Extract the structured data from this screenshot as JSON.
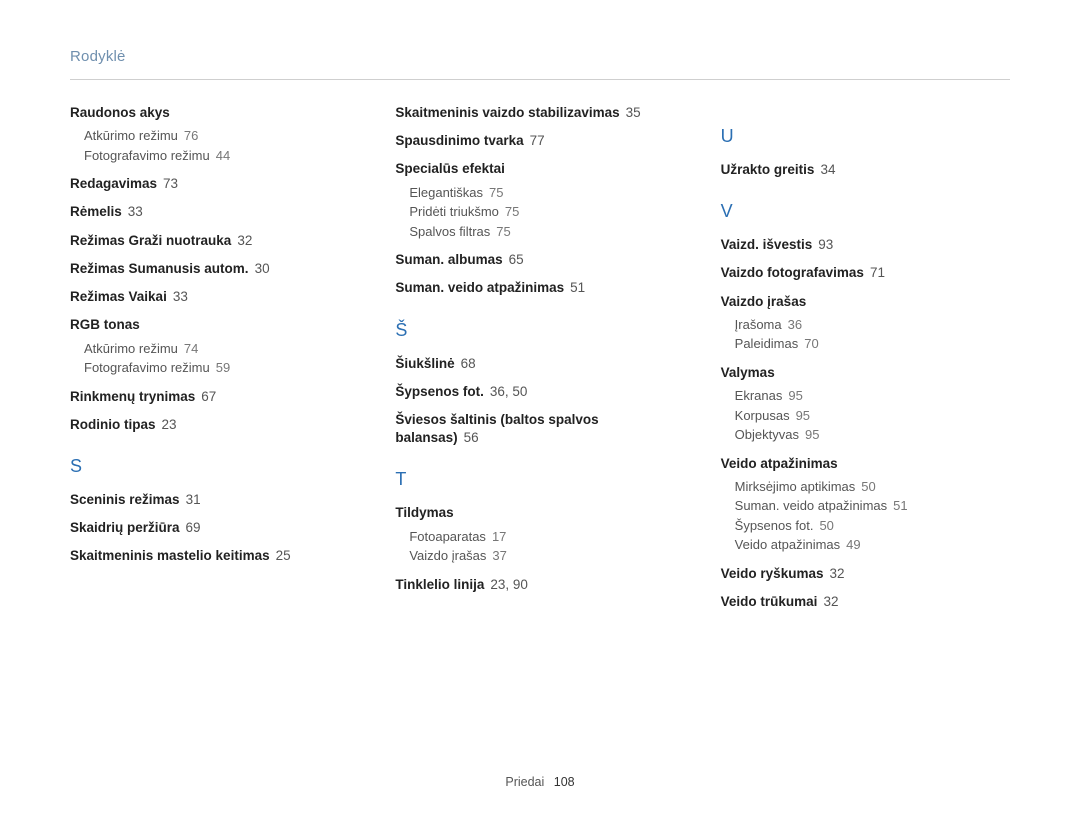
{
  "header": {
    "title": "Rodyklė"
  },
  "footer": {
    "label": "Priedai",
    "page": "108"
  },
  "columns": [
    {
      "blocks": [
        {
          "type": "entries",
          "items": [
            {
              "label": "Raudonos akys",
              "pages": "",
              "sub": [
                {
                  "label": "Atkūrimo režimu",
                  "pages": "76"
                },
                {
                  "label": "Fotografavimo režimu",
                  "pages": "44"
                }
              ]
            },
            {
              "label": "Redagavimas",
              "pages": "73"
            },
            {
              "label": "Rėmelis",
              "pages": "33"
            },
            {
              "label": "Režimas Graži nuotrauka",
              "pages": "32"
            },
            {
              "label": "Režimas Sumanusis autom.",
              "pages": "30"
            },
            {
              "label": "Režimas Vaikai",
              "pages": "33"
            },
            {
              "label": "RGB tonas",
              "pages": "",
              "sub": [
                {
                  "label": "Atkūrimo režimu",
                  "pages": "74"
                },
                {
                  "label": "Fotografavimo režimu",
                  "pages": "59"
                }
              ]
            },
            {
              "label": "Rinkmenų trynimas",
              "pages": "67"
            },
            {
              "label": "Rodinio tipas",
              "pages": "23"
            }
          ]
        },
        {
          "type": "letter",
          "value": "S"
        },
        {
          "type": "entries",
          "items": [
            {
              "label": "Sceninis režimas",
              "pages": "31"
            },
            {
              "label": "Skaidrių peržiūra",
              "pages": "69"
            },
            {
              "label": "Skaitmeninis mastelio keitimas",
              "pages": "25"
            }
          ]
        }
      ]
    },
    {
      "blocks": [
        {
          "type": "entries",
          "items": [
            {
              "label": "Skaitmeninis vaizdo stabilizavimas",
              "pages": "35"
            },
            {
              "label": "Spausdinimo tvarka",
              "pages": "77"
            },
            {
              "label": "Specialūs efektai",
              "pages": "",
              "sub": [
                {
                  "label": "Elegantiškas",
                  "pages": "75"
                },
                {
                  "label": "Pridėti triukšmo",
                  "pages": "75"
                },
                {
                  "label": "Spalvos filtras",
                  "pages": "75"
                }
              ]
            },
            {
              "label": "Suman. albumas",
              "pages": "65"
            },
            {
              "label": "Suman. veido atpažinimas",
              "pages": "51"
            }
          ]
        },
        {
          "type": "letter",
          "value": "Š"
        },
        {
          "type": "entries",
          "items": [
            {
              "label": "Šiukšlinė",
              "pages": "68"
            },
            {
              "label": "Šypsenos fot.",
              "pages": "36, 50"
            },
            {
              "label": "Šviesos šaltinis (baltos spalvos balansas)",
              "pages": "56"
            }
          ]
        },
        {
          "type": "letter",
          "value": "T"
        },
        {
          "type": "entries",
          "items": [
            {
              "label": "Tildymas",
              "pages": "",
              "sub": [
                {
                  "label": "Fotoaparatas",
                  "pages": "17"
                },
                {
                  "label": "Vaizdo įrašas",
                  "pages": "37"
                }
              ]
            },
            {
              "label": "Tinklelio linija",
              "pages": "23, 90"
            }
          ]
        }
      ]
    },
    {
      "blocks": [
        {
          "type": "letter",
          "value": "U"
        },
        {
          "type": "entries",
          "items": [
            {
              "label": "Užrakto greitis",
              "pages": "34"
            }
          ]
        },
        {
          "type": "letter",
          "value": "V"
        },
        {
          "type": "entries",
          "items": [
            {
              "label": "Vaizd. išvestis",
              "pages": "93"
            },
            {
              "label": "Vaizdo fotografavimas",
              "pages": "71"
            },
            {
              "label": "Vaizdo įrašas",
              "pages": "",
              "sub": [
                {
                  "label": "Įrašoma",
                  "pages": "36"
                },
                {
                  "label": "Paleidimas",
                  "pages": "70"
                }
              ]
            },
            {
              "label": "Valymas",
              "pages": "",
              "sub": [
                {
                  "label": "Ekranas",
                  "pages": "95"
                },
                {
                  "label": "Korpusas",
                  "pages": "95"
                },
                {
                  "label": "Objektyvas",
                  "pages": "95"
                }
              ]
            },
            {
              "label": "Veido atpažinimas",
              "pages": "",
              "sub": [
                {
                  "label": "Mirksėjimo aptikimas",
                  "pages": "50"
                },
                {
                  "label": "Suman. veido atpažinimas",
                  "pages": "51"
                },
                {
                  "label": "Šypsenos fot.",
                  "pages": "50"
                },
                {
                  "label": "Veido atpažinimas",
                  "pages": "49"
                }
              ]
            },
            {
              "label": "Veido ryškumas",
              "pages": "32"
            },
            {
              "label": "Veido trūkumai",
              "pages": "32"
            }
          ]
        }
      ]
    }
  ]
}
